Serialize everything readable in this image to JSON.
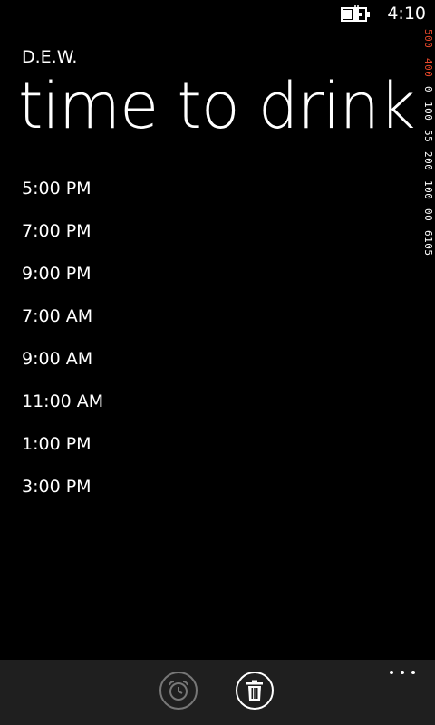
{
  "status_bar": {
    "time": "4:10",
    "battery_icon": "battery-charging-icon"
  },
  "debug_counters": [
    {
      "text": "500",
      "color": "#e8492c"
    },
    {
      "text": "400",
      "color": "#e8492c"
    },
    {
      "text": "0",
      "color": "#ffffff"
    },
    {
      "text": "100",
      "color": "#ffffff"
    },
    {
      "text": "55",
      "color": "#ffffff"
    },
    {
      "text": "200",
      "color": "#ffffff"
    },
    {
      "text": "100",
      "color": "#ffffff"
    },
    {
      "text": "00",
      "color": "#ffffff"
    },
    {
      "text": "6105",
      "color": "#ffffff"
    }
  ],
  "header": {
    "app_name": "D.E.W.",
    "page_title": "time to drink"
  },
  "times": [
    "5:00 PM",
    "7:00 PM",
    "9:00 PM",
    "7:00 AM",
    "9:00 AM",
    "11:00 AM",
    "1:00 PM",
    "3:00 PM"
  ],
  "app_bar": {
    "buttons": [
      {
        "icon": "alarm-clock-icon",
        "enabled": false
      },
      {
        "icon": "trash-icon",
        "enabled": true
      }
    ],
    "more_icon": "ellipsis-icon"
  },
  "colors": {
    "background": "#000000",
    "app_bar": "#1f1f1f",
    "accent_counter": "#e8492c"
  }
}
